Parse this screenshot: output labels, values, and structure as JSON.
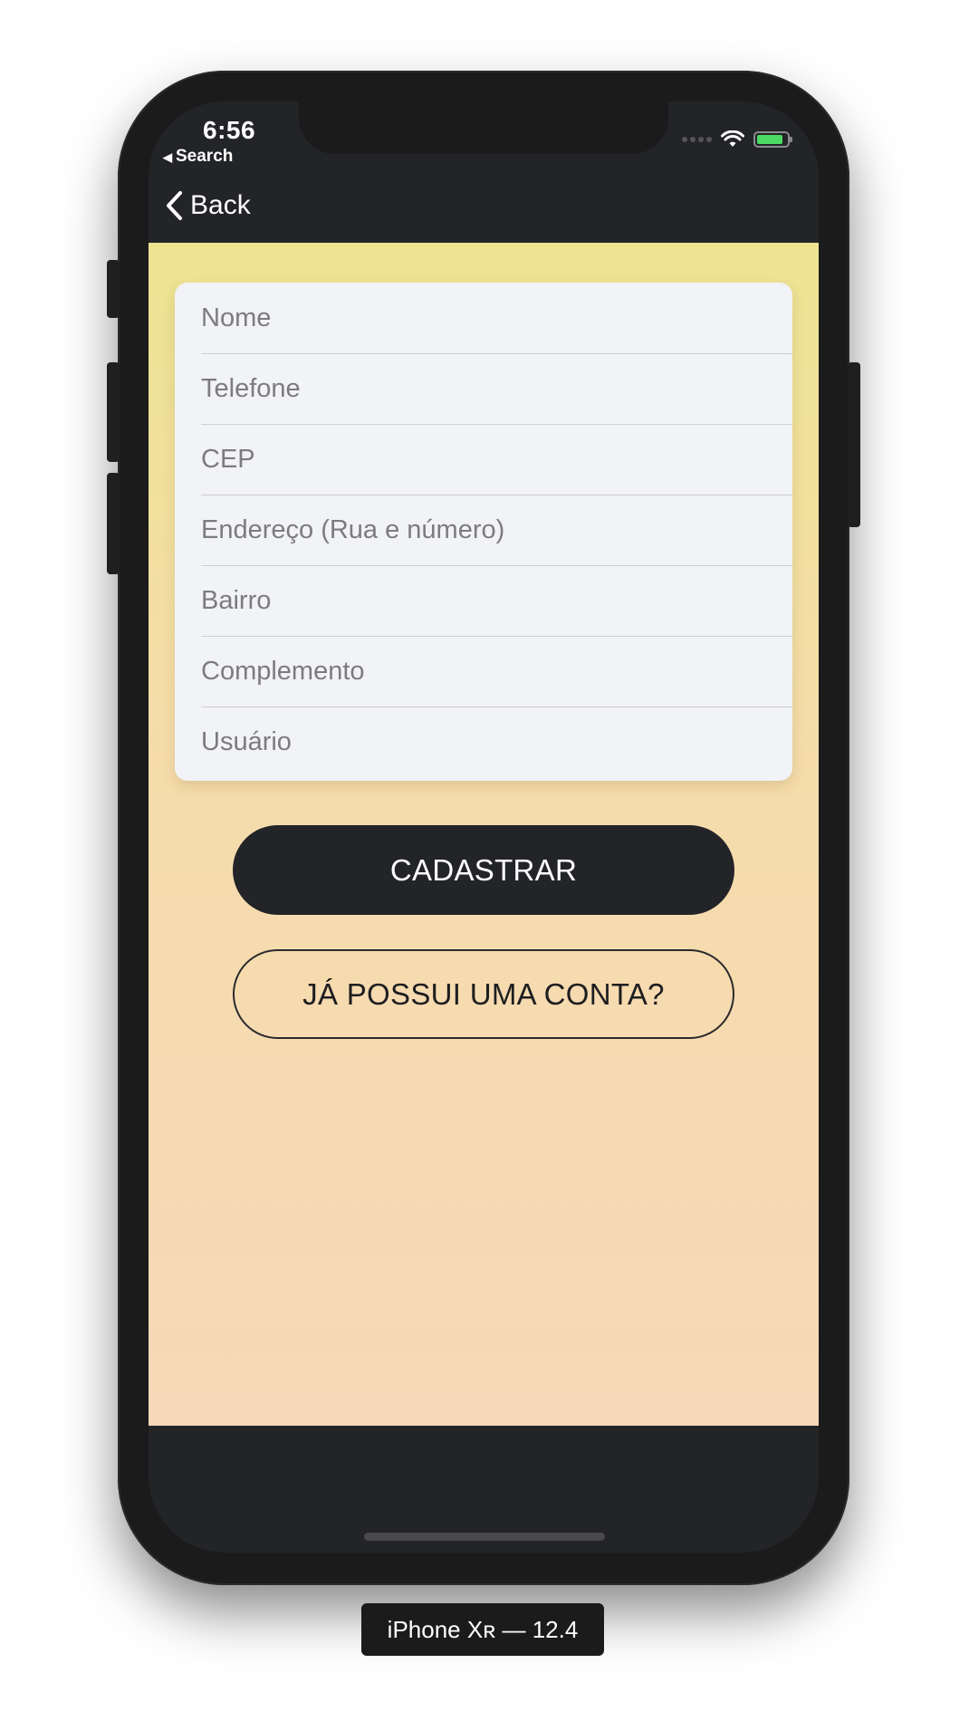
{
  "status_bar": {
    "time": "6:56",
    "back_app": "Search",
    "back_arrow": "◀",
    "wifi_icon": "wifi-icon",
    "battery_icon": "battery-charging-icon"
  },
  "nav": {
    "back_label": "Back",
    "back_icon": "chevron-left-icon"
  },
  "form": {
    "fields": [
      {
        "placeholder": "Nome"
      },
      {
        "placeholder": "Telefone"
      },
      {
        "placeholder": "CEP"
      },
      {
        "placeholder": "Endereço (Rua e número)"
      },
      {
        "placeholder": "Bairro"
      },
      {
        "placeholder": "Complemento"
      },
      {
        "placeholder": "Usuário"
      }
    ]
  },
  "buttons": {
    "register_label": "CADASTRAR",
    "login_label": "JÁ POSSUI UMA CONTA?"
  },
  "device_label": "iPhone Xʀ — 12.4",
  "colors": {
    "dark": "#232428",
    "card": "#f2f3f7",
    "gradient_top": "#ede391",
    "gradient_bottom": "#f7d8b8",
    "battery": "#4cd964"
  }
}
